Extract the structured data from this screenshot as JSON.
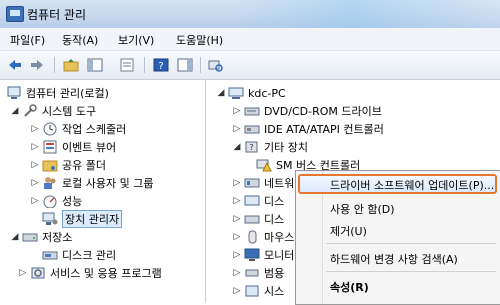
{
  "window": {
    "title": "컴퓨터 관리"
  },
  "menu": [
    "파일(F)",
    "동작(A)",
    "보기(V)",
    "도움말(H)"
  ],
  "toolbar_icons": [
    "back-arrow-icon",
    "forward-arrow-icon",
    "folder-up-icon",
    "show-hide-tree-icon",
    "properties-icon",
    "help-icon",
    "show-hide-action-pane-icon",
    "scan-hardware-icon"
  ],
  "left_tree": {
    "root": "컴퓨터 관리(로컬)",
    "system_tools": "시스템 도구",
    "task_scheduler": "작업 스케줄러",
    "event_viewer": "이벤트 뷰어",
    "shared_folders": "공유 폴더",
    "local_users": "로컬 사용자 및 그룹",
    "performance": "성능",
    "device_manager": "장치 관리자",
    "storage": "저장소",
    "disk_management": "디스크 관리",
    "services_apps": "서비스 및 응용 프로그램"
  },
  "right_tree": {
    "pc": "kdc-PC",
    "dvd": "DVD/CD-ROM 드라이브",
    "ide": "IDE ATA/ATAPI 컨트롤러",
    "other_devices": "기타 장치",
    "sm_bus": "SM 버스 컨트롤러",
    "network": "네트워",
    "disk1": "디스",
    "disk2": "디스",
    "mouse": "마우스",
    "monitor": "모니터",
    "general": "범용",
    "system": "시스"
  },
  "context_menu": {
    "update_driver": "드라이버 소프트웨어 업데이트(P)...",
    "disable": "사용 안 함(D)",
    "uninstall": "제거(U)",
    "scan": "하드웨어 변경 사항 검색(A)",
    "properties": "속성(R)"
  }
}
